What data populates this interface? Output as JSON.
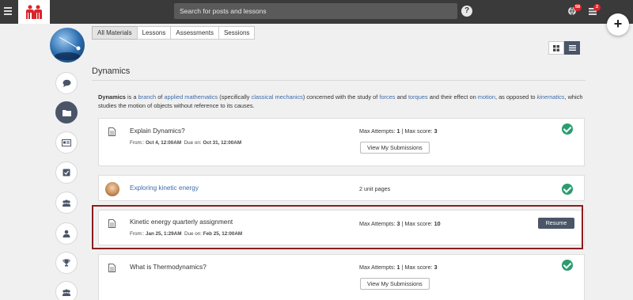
{
  "topbar": {
    "search_placeholder": "Search for posts and lessons",
    "help": "?",
    "notifications_count": "58",
    "messages_count": "2",
    "fab": "+"
  },
  "tabs": [
    "All Materials",
    "Lessons",
    "Assessments",
    "Sessions"
  ],
  "section": {
    "title": "Dynamics",
    "description_parts": {
      "t0": "Dynamics",
      "t1": " is a ",
      "l1": "branch",
      "t2": " of ",
      "l2": "applied mathematics",
      "t3": " (specifically ",
      "l3": "classical mechanics",
      "t4": ") concerned with the study of ",
      "l4": "forces",
      "t5": " and ",
      "l5": "torques",
      "t6": " and their effect on ",
      "l6": "motion",
      "t7": ", as opposed to ",
      "l7": "kinematics",
      "t8": ", which studies the motion of objects without reference to its causes."
    }
  },
  "items": [
    {
      "title": "Explain Dynamics?",
      "from_label": "From::",
      "from": "Oct 4, 12:00AM",
      "due_label": "Due on:",
      "due": "Oct 31, 12:00AM",
      "attempts_label": "Max Attempts:",
      "attempts": "1",
      "score_label": "Max score:",
      "score": "3",
      "button": "View My Submissions",
      "completed": true
    },
    {
      "title": "Exploring kinetic energy",
      "pages": "2 unit pages",
      "completed": true
    },
    {
      "title": "Kinetic energy quarterly assignment",
      "from_label": "From::",
      "from": "Jan 25, 1:29AM",
      "due_label": "Due on:",
      "due": "Feb 25, 12:00AM",
      "attempts_label": "Max Attempts:",
      "attempts": "3",
      "score_label": "Max score:",
      "score": "10",
      "button": "Resume",
      "completed": false
    },
    {
      "title": "What is Thermodynamics?",
      "attempts_label": "Max Attempts:",
      "attempts": "1",
      "score_label": "Max score:",
      "score": "3",
      "button": "View My Submissions",
      "completed": true
    }
  ],
  "colors": {
    "topbar": "#3a3a3a",
    "accent": "#4a5568",
    "link": "#3d6bab",
    "check": "#2a9d6f",
    "highlight": "#8b1d1f",
    "badge": "#d9262c"
  }
}
